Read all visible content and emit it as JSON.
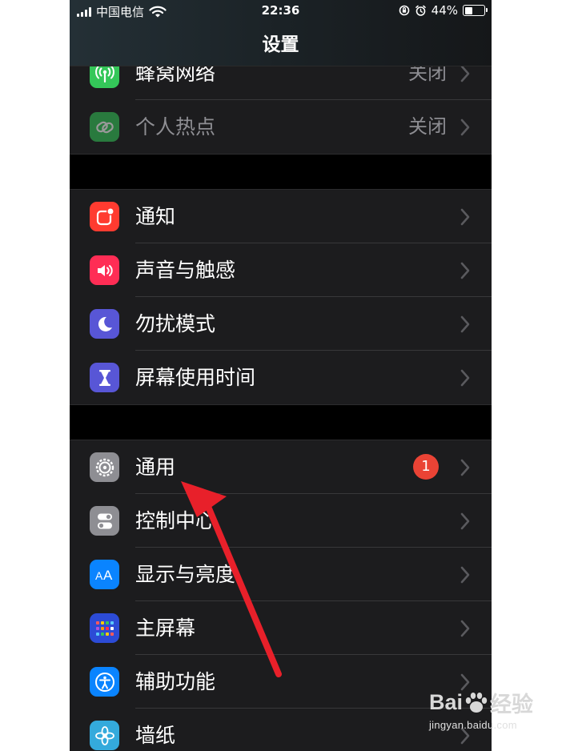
{
  "status_bar": {
    "carrier": "中国电信",
    "time": "22:36",
    "battery": "44%",
    "battery_level": 0.44
  },
  "header": {
    "title": "设置"
  },
  "groups": [
    {
      "rows": [
        {
          "label": "蜂窝网络",
          "value": "关闭",
          "icon": "antenna-icon",
          "color": "#34c759"
        },
        {
          "label": "个人热点",
          "value": "关闭",
          "icon": "chain-link-icon",
          "color": "#34c759",
          "disabled": true
        }
      ]
    },
    {
      "rows": [
        {
          "label": "通知",
          "icon": "notification-icon",
          "color": "#ff3b30"
        },
        {
          "label": "声音与触感",
          "icon": "speaker-icon",
          "color": "#ff2d55"
        },
        {
          "label": "勿扰模式",
          "icon": "moon-icon",
          "color": "#5856d6"
        },
        {
          "label": "屏幕使用时间",
          "icon": "hourglass-icon",
          "color": "#5856d6"
        }
      ]
    },
    {
      "rows": [
        {
          "label": "通用",
          "badge": "1",
          "icon": "gear-icon",
          "color": "#8e8e93"
        },
        {
          "label": "控制中心",
          "icon": "toggles-icon",
          "color": "#8e8e93"
        },
        {
          "label": "显示与亮度",
          "icon": "text-size-icon",
          "color": "#0a84ff"
        },
        {
          "label": "主屏幕",
          "icon": "app-grid-icon",
          "color": "#2c4bd6"
        },
        {
          "label": "辅助功能",
          "icon": "accessibility-icon",
          "color": "#0a84ff"
        },
        {
          "label": "墙纸",
          "icon": "flower-icon",
          "color": "#34aadc"
        }
      ]
    }
  ],
  "watermark": {
    "brand_left": "Bai",
    "brand_right": "经验",
    "url": "jingyan.baidu.com"
  }
}
